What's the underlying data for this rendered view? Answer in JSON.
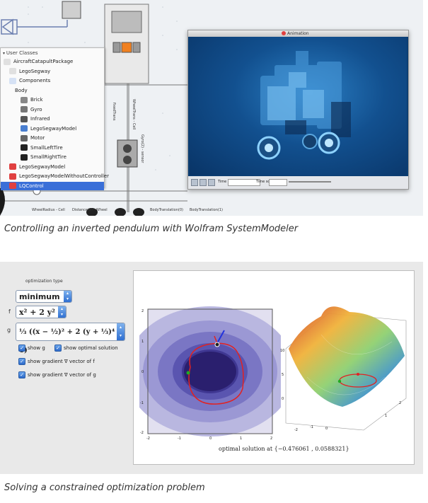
{
  "captions": {
    "top": "Controlling an inverted pendulum with Wolfram SystemModeler",
    "bottom": "Solving a constrained optimization problem"
  },
  "modeler": {
    "tree_header": "User Classes",
    "tree_items": [
      {
        "label": "AircraftCatapultPackage",
        "indent": 0,
        "icon": "package-icon",
        "color": "#e0e0e0"
      },
      {
        "label": "LegoSegway",
        "indent": 1,
        "icon": "package-icon",
        "color": "#e0e0e0"
      },
      {
        "label": "Components",
        "indent": 1,
        "icon": "folder-icon",
        "color": "#d6e2f5"
      },
      {
        "label": "Body",
        "indent": 2,
        "icon": "",
        "color": ""
      },
      {
        "label": "Brick",
        "indent": 3,
        "icon": "brick-icon",
        "color": "#888888"
      },
      {
        "label": "Gyro",
        "indent": 3,
        "icon": "gyro-icon",
        "color": "#777777"
      },
      {
        "label": "Infrared",
        "indent": 3,
        "icon": "infrared-icon",
        "color": "#555555"
      },
      {
        "label": "LegoSegwayModel",
        "indent": 3,
        "icon": "model-icon",
        "color": "#4a7fd0"
      },
      {
        "label": "Motor",
        "indent": 3,
        "icon": "motor-icon",
        "color": "#666666"
      },
      {
        "label": "SmallLeftTire",
        "indent": 3,
        "icon": "tire-icon",
        "color": "#222222"
      },
      {
        "label": "SmallRightTire",
        "indent": 3,
        "icon": "tire-icon",
        "color": "#222222"
      },
      {
        "label": "LegoSegwayModel",
        "indent": 1,
        "icon": "model-icon",
        "color": "#e04040"
      },
      {
        "label": "LegoSegwayModelWithoutController",
        "indent": 1,
        "icon": "model-icon",
        "color": "#e04040"
      },
      {
        "label": "LQControl",
        "indent": 1,
        "icon": "control-icon",
        "color": "#e04040",
        "selected": true
      }
    ],
    "bottom_labels": [
      "WheelRadius - Cell",
      "Distance(2) - Wheel",
      "BodyTranslation(0)",
      "BodyTranslation(1)"
    ],
    "vertical_labels": [
      "WheelTrans - Cell",
      "fixedTrans",
      "Gyro(2) - sensor"
    ],
    "sim_window": {
      "title": "Animation",
      "controls": [
        "Time",
        "Time scale"
      ]
    }
  },
  "optimization": {
    "type_label": "optimization type",
    "type_value": "minimum",
    "f_label": "f",
    "f_value": "x² + 2 y²",
    "g_label": "g",
    "g_value": "⅓ ((x − ½)² + 2 (y + ⅓)⁴ − 1)",
    "checkboxes": [
      {
        "label": "show g",
        "checked": true
      },
      {
        "label": "show optimal solution",
        "checked": true
      },
      {
        "label": "show gradient ∇ vector of f",
        "checked": true
      },
      {
        "label": "show gradient ∇ vector of g",
        "checked": true
      }
    ],
    "result_text": "optimal solution at {−0.476061 , 0.0588321}",
    "contour_x_ticks": [
      "-2",
      "-1",
      "0",
      "1",
      "2"
    ],
    "contour_y_ticks": [
      "2",
      "1",
      "0",
      "-1",
      "-2"
    ],
    "surface_z_ticks": [
      "10",
      "5",
      "0"
    ],
    "surface_x_ticks": [
      "-2",
      "-1",
      "0",
      "1",
      "2"
    ],
    "colors": {
      "contour_dark": "#2a1f6e",
      "contour_mid": "#5a55b0",
      "contour_light": "#b9b7e0",
      "constraint": "#e22222",
      "gradient_f": "#2233dd",
      "optimal_point": "#22aa22"
    }
  }
}
